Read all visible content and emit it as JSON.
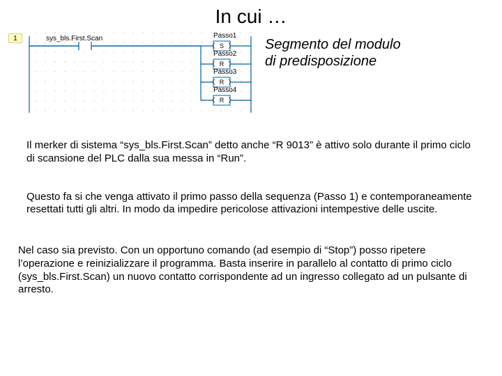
{
  "title": "In cui …",
  "diagram": {
    "rung_number": "1",
    "contact_label": "sys_bls.First.Scan",
    "coils": [
      {
        "label": "Passo1",
        "type": "S"
      },
      {
        "label": "Passo2",
        "type": "R"
      },
      {
        "label": "Passo3",
        "type": "R"
      },
      {
        "label": "Passo4",
        "type": "R"
      }
    ]
  },
  "caption_line1": "Segmento del modulo",
  "caption_line2": "di predisposizione",
  "para1": "Il merker di sistema “sys_bls.First.Scan” detto anche “R 9013” è attivo solo durante il primo ciclo di scansione del PLC dalla sua messa in “Run”.",
  "para2": "Questo fa si che venga attivato il primo passo della sequenza (Passo 1) e contemporaneamente resettati tutti gli altri. In modo da impedire pericolose attivazioni intempestive delle uscite.",
  "para3": "Nel caso sia previsto. Con un opportuno comando (ad esempio di “Stop”) posso ripetere l’operazione e reinizializzare il programma. Basta inserire in parallelo al contatto di primo ciclo (sys_bls.First.Scan) un nuovo contatto corrispondente ad un ingresso collegato ad un pulsante di arresto."
}
